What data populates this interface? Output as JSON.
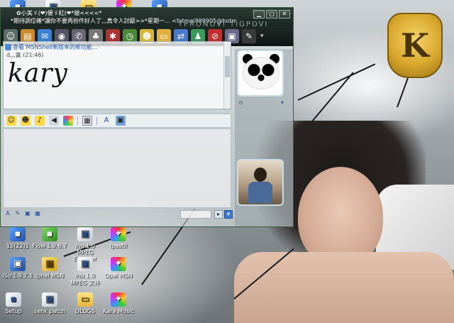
{
  "window": {
    "title_line1": "✿小美ゞ(❤)優ゞ紅(❤*爺<<<<*",
    "title_line2_status": "*期待調位確*讓你不要再扮作好人了,,,真令人討厭>>*星期一...",
    "title_line2_email": "<fatmei999905@hotmail.com>",
    "title_ghost": "YPRONOVI TIGPOVI",
    "controls": {
      "minimize": "▁",
      "maximize": "□",
      "close": "✕"
    }
  },
  "toolbar": {
    "icons": [
      "invite-icon",
      "send-file-icon",
      "mail-icon",
      "webcam-icon",
      "phone-icon",
      "games-icon",
      "activities-icon",
      "clock-icon",
      "smile-icon",
      "folder-icon",
      "share-icon",
      "contacts-icon",
      "block-icon",
      "display-picture-icon",
      "background-icon"
    ],
    "more_label": "▾"
  },
  "conversation": {
    "notice": "查看 MSNShell新版本的新功能...",
    "sender": "d,,,富 (21:46)",
    "message": "kary"
  },
  "format_bar": {
    "icons": [
      "emoticon-icon",
      "wink-icon",
      "voice-clip-icon",
      "nudge-icon",
      "background-icon",
      "draw-icon",
      "font-icon",
      "color-icon"
    ]
  },
  "bottom_bar": {
    "icons": [
      "font-a-icon",
      "pen-icon",
      "image-icon",
      "grid-icon"
    ],
    "send": "▸",
    "dropdown": "▾"
  },
  "desktop_icons": [
    {
      "label": "15(22)1",
      "glyph": "▪"
    },
    {
      "label": "Flow 1.9.6.7",
      "glyph": "▪"
    },
    {
      "label": "Inu 1.0 MPEG Encoder",
      "glyph": "▣"
    },
    {
      "label": "Ipastil",
      "glyph": "✦"
    },
    {
      "label": "iSo 1.9.7.1",
      "glyph": "▣"
    },
    {
      "label": "Ipnal MSN",
      "glyph": "▣"
    },
    {
      "label": "Inu 1.0 MPEG 文件",
      "glyph": "▣"
    },
    {
      "label": "Opal MSN",
      "glyph": "✦"
    },
    {
      "label": "Setup",
      "glyph": "▪"
    },
    {
      "label": "sehk patch",
      "glyph": "▣"
    },
    {
      "label": "DLOGS",
      "glyph": "▭"
    },
    {
      "label": "Kara Music",
      "glyph": "✦"
    }
  ],
  "top_icons": [
    "setup-top-icon",
    "mycomputer-top-icon",
    "network-top-icon",
    "docs-top-icon"
  ],
  "crest_letter": "K"
}
